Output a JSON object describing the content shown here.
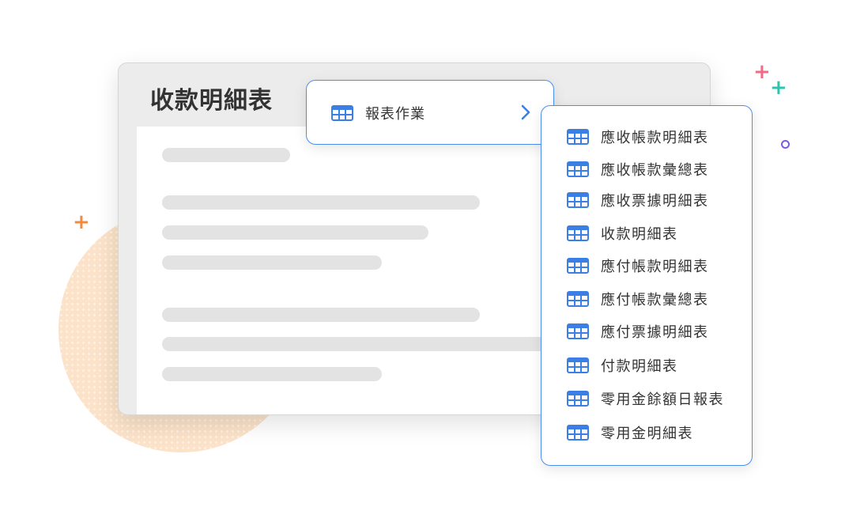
{
  "window": {
    "title": "收款明細表"
  },
  "primary_menu": {
    "label": "報表作業",
    "icon": "table-icon",
    "chevron_icon": "chevron-right-icon"
  },
  "submenu": {
    "items": [
      {
        "label": "應收帳款明細表",
        "icon": "table-icon"
      },
      {
        "label": "應收帳款彙總表",
        "icon": "table-icon"
      },
      {
        "label": "應收票據明細表",
        "icon": "table-icon"
      },
      {
        "label": "收款明細表",
        "icon": "table-icon"
      },
      {
        "label": "應付帳款明細表",
        "icon": "table-icon"
      },
      {
        "label": "應付帳款彙總表",
        "icon": "table-icon"
      },
      {
        "label": "應付票據明細表",
        "icon": "table-icon"
      },
      {
        "label": "付款明細表",
        "icon": "table-icon"
      },
      {
        "label": "零用金餘額日報表",
        "icon": "table-icon"
      },
      {
        "label": "零用金明細表",
        "icon": "table-icon"
      }
    ]
  },
  "colors": {
    "accent": "#4a8ff0",
    "icon_blue": "#3b7fe4",
    "text": "#333333",
    "skeleton": "#e3e3e3",
    "decor_orange": "#f58a3c",
    "decor_pink": "#f06b86",
    "decor_teal": "#2bc6b0",
    "decor_purple": "#7b5ce0"
  }
}
